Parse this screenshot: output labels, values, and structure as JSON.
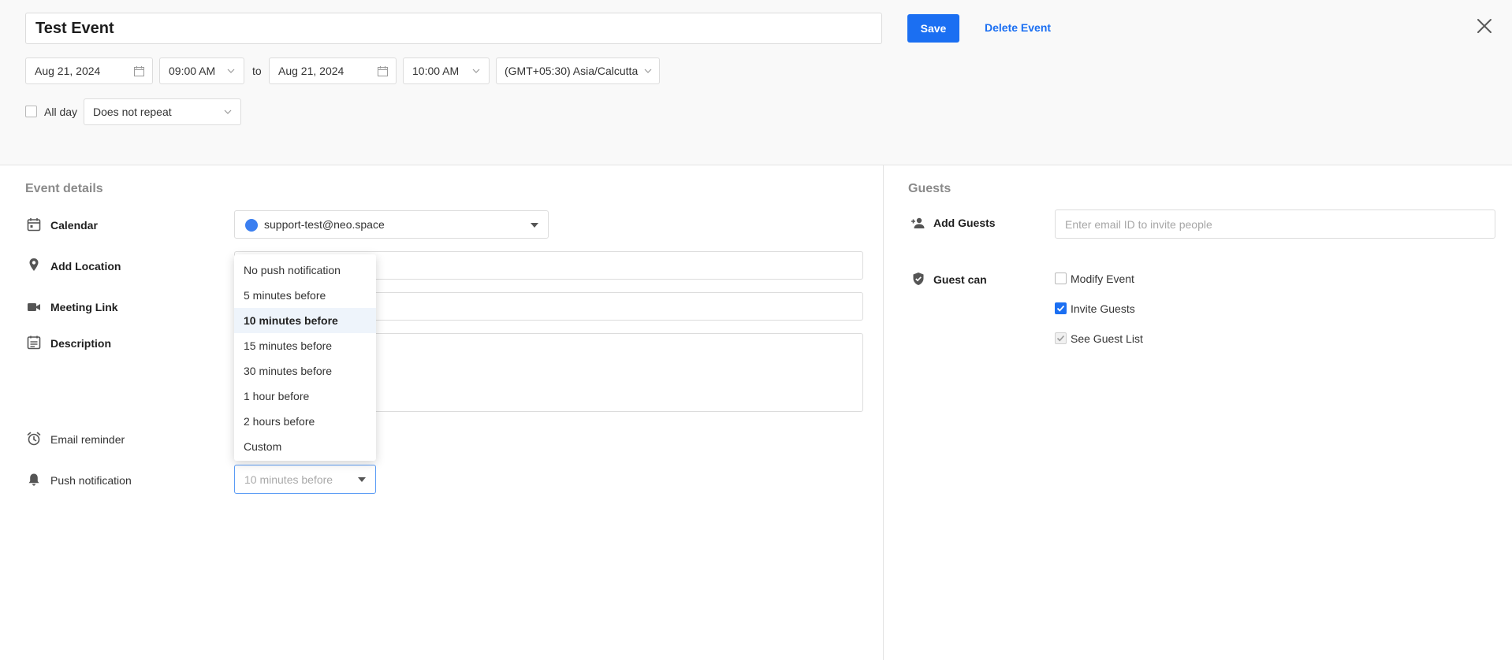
{
  "header": {
    "title_value": "Test Event",
    "save_label": "Save",
    "delete_label": "Delete Event"
  },
  "datetime": {
    "start_date": "Aug 21, 2024",
    "start_time": "09:00 AM",
    "to_label": "to",
    "end_date": "Aug 21, 2024",
    "end_time": "10:00 AM",
    "timezone": "(GMT+05:30) Asia/Calcutta"
  },
  "options": {
    "all_day_label": "All day",
    "all_day_checked": false,
    "repeat_value": "Does not repeat"
  },
  "event_details": {
    "section_title": "Event details",
    "calendar_label": "Calendar",
    "calendar_value": "support-test@neo.space",
    "calendar_color": "#3b7ff0",
    "location_label": "Add Location",
    "meeting_label": "Meeting Link",
    "description_label": "Description",
    "email_reminder_label": "Email reminder",
    "push_label": "Push notification",
    "push_value": "10 minutes before"
  },
  "push_dropdown": {
    "options": [
      "No push notification",
      "5 minutes before",
      "10 minutes before",
      "15 minutes before",
      "30 minutes before",
      "1 hour before",
      "2 hours before",
      "Custom"
    ],
    "selected_index": 2
  },
  "guests": {
    "section_title": "Guests",
    "add_label": "Add Guests",
    "add_placeholder": "Enter email ID to invite people",
    "guest_can_label": "Guest can",
    "permissions": [
      {
        "label": "Modify Event",
        "checked": false
      },
      {
        "label": "Invite Guests",
        "checked": true
      },
      {
        "label": "See Guest List",
        "checked": true
      }
    ]
  },
  "colors": {
    "accent": "#1b6ff2"
  }
}
